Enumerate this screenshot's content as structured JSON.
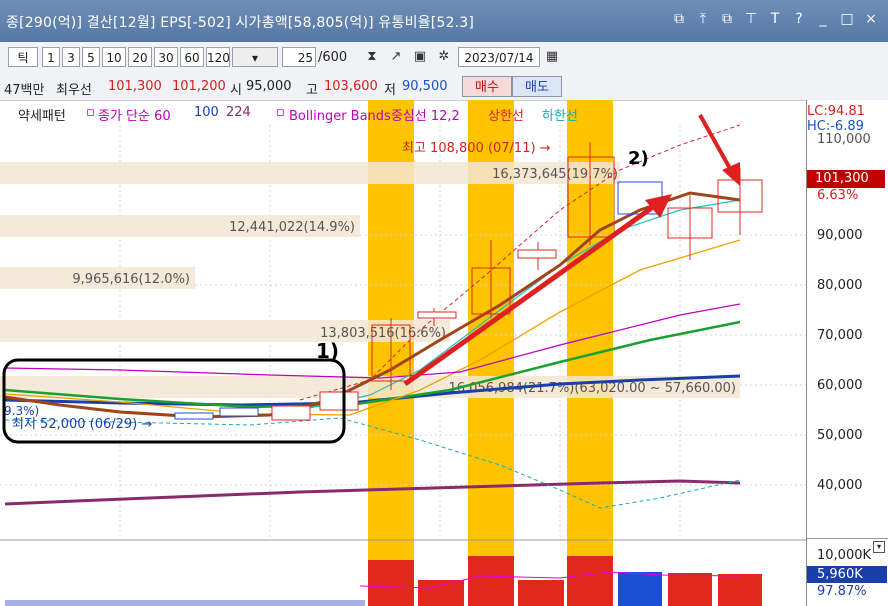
{
  "title_bar": {
    "text": "종[290(억)] 결산[12월] EPS[-502] 시가총액[58,805(억)] 유통비율[52.3]",
    "icons": [
      "share-icon",
      "pin-icon",
      "restore-icon",
      "pin-down-icon",
      "text-icon",
      "help-icon",
      "minimize-icon",
      "maximize-icon",
      "close-icon"
    ],
    "icon_glyphs": [
      "⧉",
      "⤒",
      "⧉",
      "⊤",
      "T",
      "?",
      "_",
      "□",
      "×"
    ]
  },
  "toolbar": {
    "tick_label": "틱",
    "intervals": [
      "1",
      "3",
      "5",
      "10",
      "20",
      "30",
      "60",
      "120"
    ],
    "count_value": "25",
    "count_total": "/600",
    "date_value": "2023/07/14"
  },
  "price_bar": {
    "volume_text": "47백만",
    "best_label": "최우선",
    "best_ask": "101,300",
    "best_bid": "101,200",
    "open_label": "시",
    "open_value": "95,000",
    "high_label": "고",
    "high_value": "103,600",
    "low_label": "저",
    "low_value": "90,500",
    "buy_label": "매수",
    "sell_label": "매도"
  },
  "legend": {
    "pattern_label": "약세패턴",
    "ma_label": "종가 단순 60",
    "ma_100": "100",
    "ma_224": "224",
    "bb_label": "Bollinger Bands중심선 12,2",
    "upper_label": "상한선",
    "lower_label": "하한선"
  },
  "y_axis": {
    "lc": "LC:94.81",
    "hc": "HC:-6.89",
    "ticks": [
      "110,000",
      "90,000",
      "80,000",
      "70,000",
      "60,000",
      "50,000",
      "40,000"
    ],
    "current_price": "101,300",
    "current_pct": "6.63%",
    "volume_max": "10,000K",
    "volume_current": "5,960K",
    "volume_pct": "97.87%"
  },
  "annotations": {
    "high_label": "최고 108,800 (07/11) →",
    "low_label": "최저 52,000 (06/29) →",
    "label_1": "1)",
    "label_2": "2)",
    "vp1": "16,373,645(19.7%)",
    "vp2": "12,441,022(14.9%)",
    "vp3": "9,965,616(12.0%)",
    "vp4": "13,803,516(16.6%)",
    "vp5": "16,056,984(21.7%)(63,020.00 ~ 57,660.00)",
    "left_cut": "9.3%)"
  },
  "colors": {
    "up": "#e0281d",
    "down": "#1b4fd1",
    "highlight": "#ffc400",
    "bb": "#c000c0",
    "ma_green": "#1aa030",
    "ma_blue": "#1b3fa8",
    "ma_purple": "#8b2a6a",
    "ma_brown": "#a0441a"
  }
}
